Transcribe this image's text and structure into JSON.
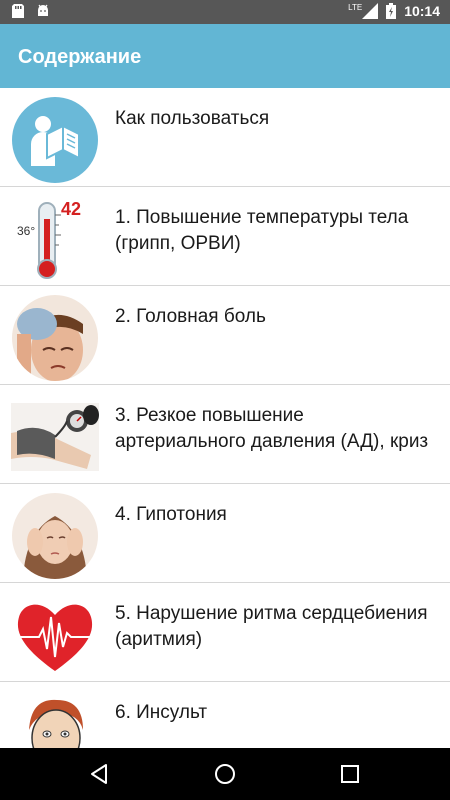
{
  "status_bar": {
    "network": "LTE",
    "time": "10:14"
  },
  "app_bar": {
    "title": "Содержание"
  },
  "items": [
    {
      "label": "Как пользоваться",
      "icon": "reader-icon"
    },
    {
      "label": "1. Повышение температуры тела (грипп, ОРВИ)",
      "icon": "thermometer-icon",
      "thermo_high": "42",
      "thermo_low": "36°"
    },
    {
      "label": "2. Головная боль",
      "icon": "headache-icon"
    },
    {
      "label": "3. Резкое повышение артериального давления (АД), криз",
      "icon": "blood-pressure-icon"
    },
    {
      "label": "4. Гипотония",
      "icon": "hypotension-icon"
    },
    {
      "label": "5. Нарушение ритма сердцебиения (аритмия)",
      "icon": "heart-icon"
    },
    {
      "label": "6. Инсульт",
      "icon": "stroke-icon"
    }
  ],
  "colors": {
    "app_bar": "#62b6d4",
    "status_bar": "#575757",
    "nav_bar": "#000000",
    "divider": "#d6d6d6"
  }
}
